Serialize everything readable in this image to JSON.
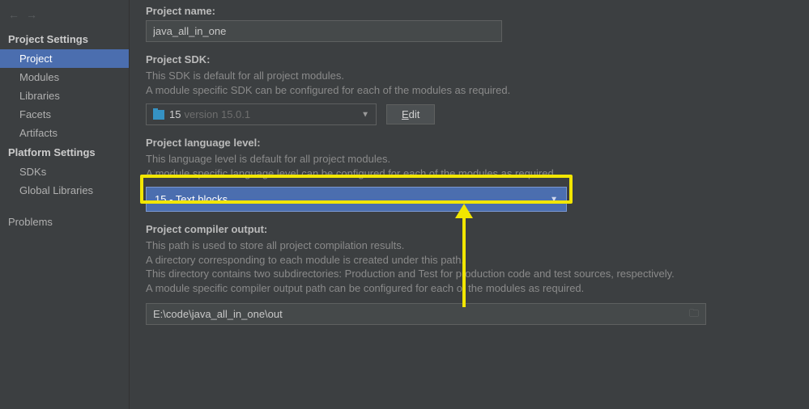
{
  "sidebar": {
    "sections": {
      "project_settings": {
        "label": "Project Settings",
        "items": [
          "Project",
          "Modules",
          "Libraries",
          "Facets",
          "Artifacts"
        ]
      },
      "platform_settings": {
        "label": "Platform Settings",
        "items": [
          "SDKs",
          "Global Libraries"
        ]
      }
    },
    "problems": "Problems",
    "selected": "Project"
  },
  "form": {
    "name_label": "Project name:",
    "name_value": "java_all_in_one",
    "sdk_label": "Project SDK:",
    "sdk_desc1": "This SDK is default for all project modules.",
    "sdk_desc2": "A module specific SDK can be configured for each of the modules as required.",
    "sdk_selected_name": "15",
    "sdk_selected_ver": "version 15.0.1",
    "edit_btn": "Edit",
    "lang_label": "Project language level:",
    "lang_desc1": "This language level is default for all project modules.",
    "lang_desc2": "A module specific language level can be configured for each of the modules as required.",
    "lang_selected": "15 - Text blocks",
    "out_label": "Project compiler output:",
    "out_desc1": "This path is used to store all project compilation results.",
    "out_desc2": "A directory corresponding to each module is created under this path.",
    "out_desc3": "This directory contains two subdirectories: Production and Test for production code and test sources, respectively.",
    "out_desc4": "A module specific compiler output path can be configured for each of the modules as required.",
    "out_value": "E:\\code\\java_all_in_one\\out"
  },
  "annotation": {
    "color": "#f2e600"
  }
}
